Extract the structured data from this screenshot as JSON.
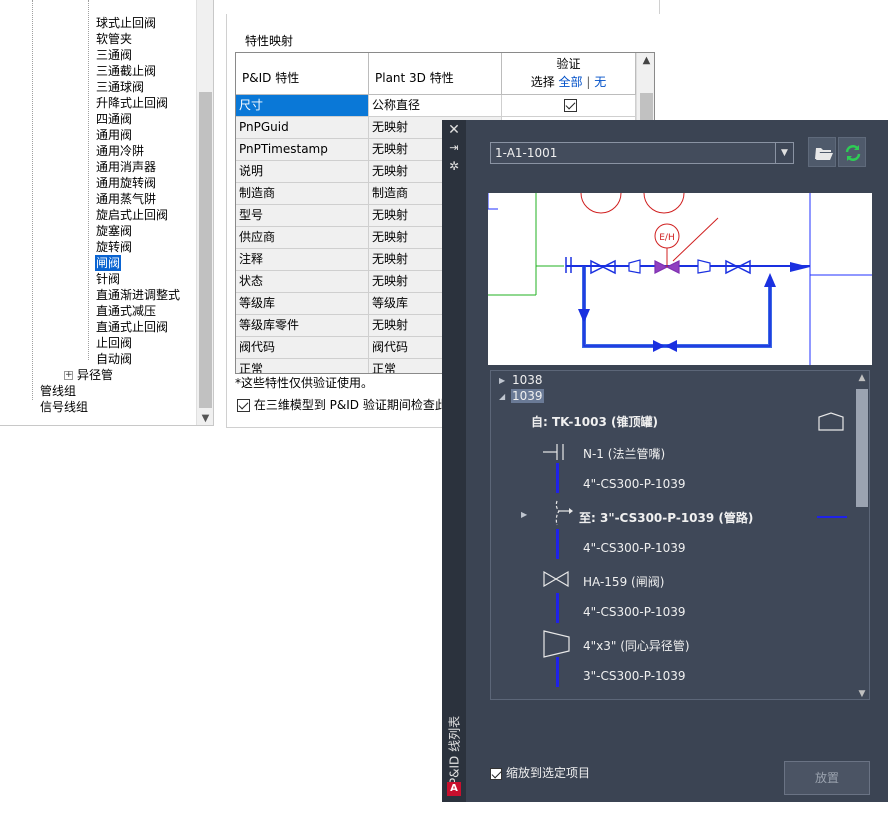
{
  "tree": {
    "items": [
      "球式止回阀",
      "软管夹",
      "三通阀",
      "三通截止阀",
      "三通球阀",
      "升降式止回阀",
      "四通阀",
      "通用阀",
      "通用冷阱",
      "通用消声器",
      "通用旋转阀",
      "通用蒸气阱",
      "旋启式止回阀",
      "旋塞阀",
      "旋转阀",
      "闸阀",
      "针阀",
      "直通渐进调整式",
      "直通式减压",
      "直通式止回阀",
      "止回阀",
      "自动阀"
    ],
    "selected_item": "闸阀",
    "group_item": "异径管",
    "root_items": [
      "管线组",
      "信号线组"
    ]
  },
  "mapping": {
    "title": "特性映射",
    "col_pid": "P&ID 特性",
    "col_p3d": "Plant 3D 特性",
    "col_verify": "验证",
    "select_label": "选择",
    "select_all": "全部",
    "separator": "|",
    "select_none": "无",
    "rows": [
      {
        "pid": "尺寸",
        "p3d": "公称直径"
      },
      {
        "pid": "PnPGuid",
        "p3d": "无映射"
      },
      {
        "pid": "PnPTimestamp",
        "p3d": "无映射"
      },
      {
        "pid": "说明",
        "p3d": "无映射"
      },
      {
        "pid": "制造商",
        "p3d": "制造商"
      },
      {
        "pid": "型号",
        "p3d": "无映射"
      },
      {
        "pid": "供应商",
        "p3d": "无映射"
      },
      {
        "pid": "注释",
        "p3d": "无映射"
      },
      {
        "pid": "状态",
        "p3d": "无映射"
      },
      {
        "pid": "等级库",
        "p3d": "等级库"
      },
      {
        "pid": "等级库零件",
        "p3d": "无映射"
      },
      {
        "pid": "阀代码",
        "p3d": "阀代码"
      },
      {
        "pid": "正常",
        "p3d": "正常"
      }
    ],
    "note": "*这些特性仅供验证使用。",
    "check_label": "在三维模型到 P&ID 验证期间检查此"
  },
  "palette": {
    "title": "P&ID 线列表",
    "drawing_value": "1-A1-1001",
    "preview_labels": [
      "E/H"
    ],
    "lines": [
      {
        "kind": "node",
        "text": "1038"
      },
      {
        "kind": "node",
        "text": "1039"
      },
      {
        "kind": "from",
        "text": "自: TK-1003 (锥顶罐)"
      },
      {
        "kind": "item",
        "text": "N-1 (法兰管嘴)"
      },
      {
        "kind": "pipe",
        "text": "4\"-CS300-P-1039"
      },
      {
        "kind": "to",
        "text": "至: 3\"-CS300-P-1039 (管路)"
      },
      {
        "kind": "pipe",
        "text": "4\"-CS300-P-1039"
      },
      {
        "kind": "item",
        "text": "HA-159 (闸阀)"
      },
      {
        "kind": "pipe",
        "text": "4\"-CS300-P-1039"
      },
      {
        "kind": "item",
        "text": "4\"x3\" (同心异径管)"
      },
      {
        "kind": "pipe",
        "text": "3\"-CS300-P-1039"
      }
    ],
    "zoom_label": "缩放到选定项目",
    "place_label": "放置",
    "colors": {
      "background": "#3b4453",
      "pipe": "#1f22e8",
      "accent": "#0a78d7"
    }
  }
}
